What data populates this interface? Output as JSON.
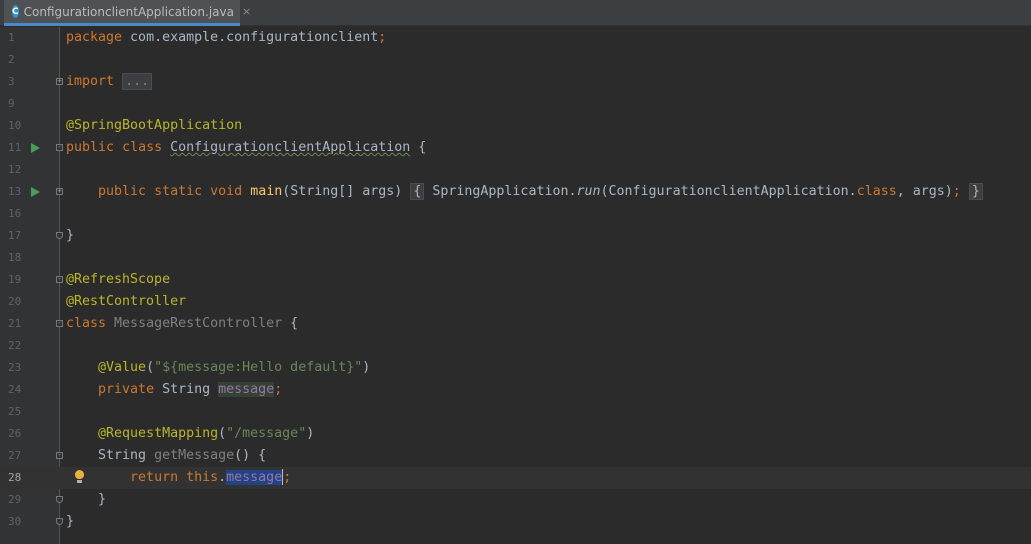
{
  "tab": {
    "icon": "java-class-icon",
    "icon_glyph": "C",
    "title": "ConfigurationclientApplication.java",
    "close": "×"
  },
  "lines": [
    {
      "num": "1"
    },
    {
      "num": "2"
    },
    {
      "num": "3"
    },
    {
      "num": "9"
    },
    {
      "num": "10"
    },
    {
      "num": "11"
    },
    {
      "num": "12"
    },
    {
      "num": "13"
    },
    {
      "num": "16"
    },
    {
      "num": "17"
    },
    {
      "num": "18"
    },
    {
      "num": "19"
    },
    {
      "num": "20"
    },
    {
      "num": "21"
    },
    {
      "num": "22"
    },
    {
      "num": "23"
    },
    {
      "num": "24"
    },
    {
      "num": "25"
    },
    {
      "num": "26"
    },
    {
      "num": "27"
    },
    {
      "num": "28"
    },
    {
      "num": "29"
    },
    {
      "num": "30"
    }
  ],
  "code": {
    "l1_kw": "package",
    "l1_rest": " com.example.configurationclient",
    "semi": ";",
    "l3_kw": "import",
    "l3_fold": "...",
    "l10_ann": "@SpringBootApplication",
    "public": "public",
    "class": "class",
    "cls_name": "ConfigurationclientApplication",
    "brace_open": " {",
    "static": "static",
    "void": "void",
    "main": "main",
    "main_args": "(String[] args)",
    "lbrace": "{",
    "rbrace": "}",
    "spring_app": "SpringApplication.",
    "run": "run",
    "run_args1": "(ConfigurationclientApplication.",
    "run_class_kw": "class",
    "run_args2": ", args)",
    "l17": "}",
    "l19_ann": "@RefreshScope",
    "l20_ann": "@RestController",
    "l21_cls": "MessageRestController",
    "value_ann": "@Value",
    "lp": "(",
    "rp": ")",
    "value_str": "\"${message:Hello default}\"",
    "private": "private",
    "string_type": "String",
    "message": "message",
    "rm_ann": "@RequestMapping",
    "rm_str": "\"/message\"",
    "get_message": "getMessage",
    "parens_brace": "() {",
    "return": "return",
    "this": "this",
    "dot": ".",
    "l29": "}",
    "l30": "}"
  }
}
